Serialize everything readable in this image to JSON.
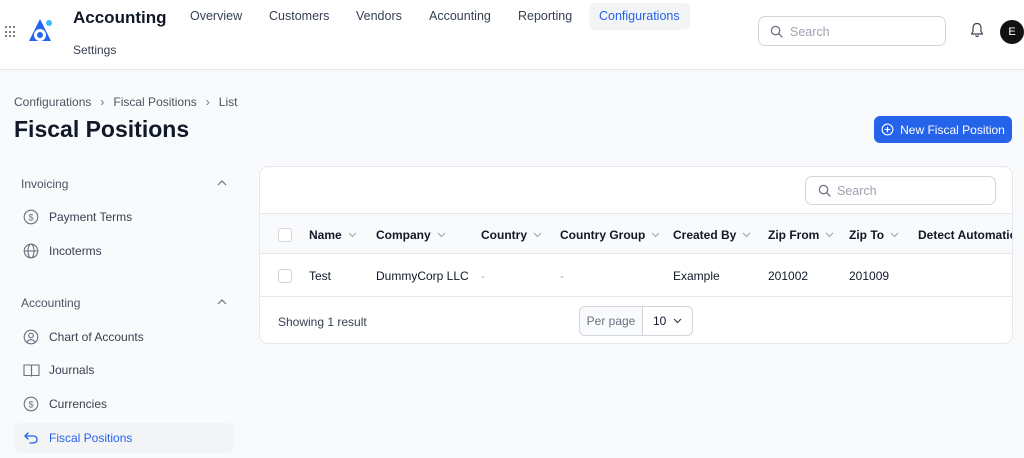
{
  "app": {
    "title": "Accounting",
    "settings_label": "Settings",
    "avatar_initial": "E"
  },
  "nav": {
    "items": [
      {
        "label": "Overview"
      },
      {
        "label": "Customers"
      },
      {
        "label": "Vendors"
      },
      {
        "label": "Accounting"
      },
      {
        "label": "Reporting"
      },
      {
        "label": "Configurations",
        "active": true
      }
    ]
  },
  "top_search": {
    "placeholder": "Search"
  },
  "breadcrumb": [
    "Configurations",
    "Fiscal Positions",
    "List"
  ],
  "page": {
    "title": "Fiscal Positions",
    "new_button": "New Fiscal Position"
  },
  "sidebar": {
    "groups": [
      {
        "label": "Invoicing",
        "items": [
          {
            "label": "Payment Terms",
            "icon": "dollar-circle-icon"
          },
          {
            "label": "Incoterms",
            "icon": "globe-icon"
          }
        ]
      },
      {
        "label": "Accounting",
        "items": [
          {
            "label": "Chart of Accounts",
            "icon": "user-circle-icon"
          },
          {
            "label": "Journals",
            "icon": "book-icon"
          },
          {
            "label": "Currencies",
            "icon": "dollar-circle-icon"
          },
          {
            "label": "Fiscal Positions",
            "icon": "arrow-uturn-left-icon",
            "active": true
          }
        ]
      }
    ]
  },
  "table": {
    "search_placeholder": "Search",
    "columns": [
      "Name",
      "Company",
      "Country",
      "Country Group",
      "Created By",
      "Zip From",
      "Zip To",
      "Detect Automatica"
    ],
    "rows": [
      [
        "Test",
        "DummyCorp LLC",
        "-",
        "-",
        "Example",
        "201002",
        "201009",
        ""
      ]
    ],
    "footer": {
      "result_text": "Showing 1 result",
      "per_page_label": "Per page",
      "per_page_value": "10"
    }
  },
  "colors": {
    "accent": "#2563eb",
    "active_bg": "#f3f4f6"
  }
}
